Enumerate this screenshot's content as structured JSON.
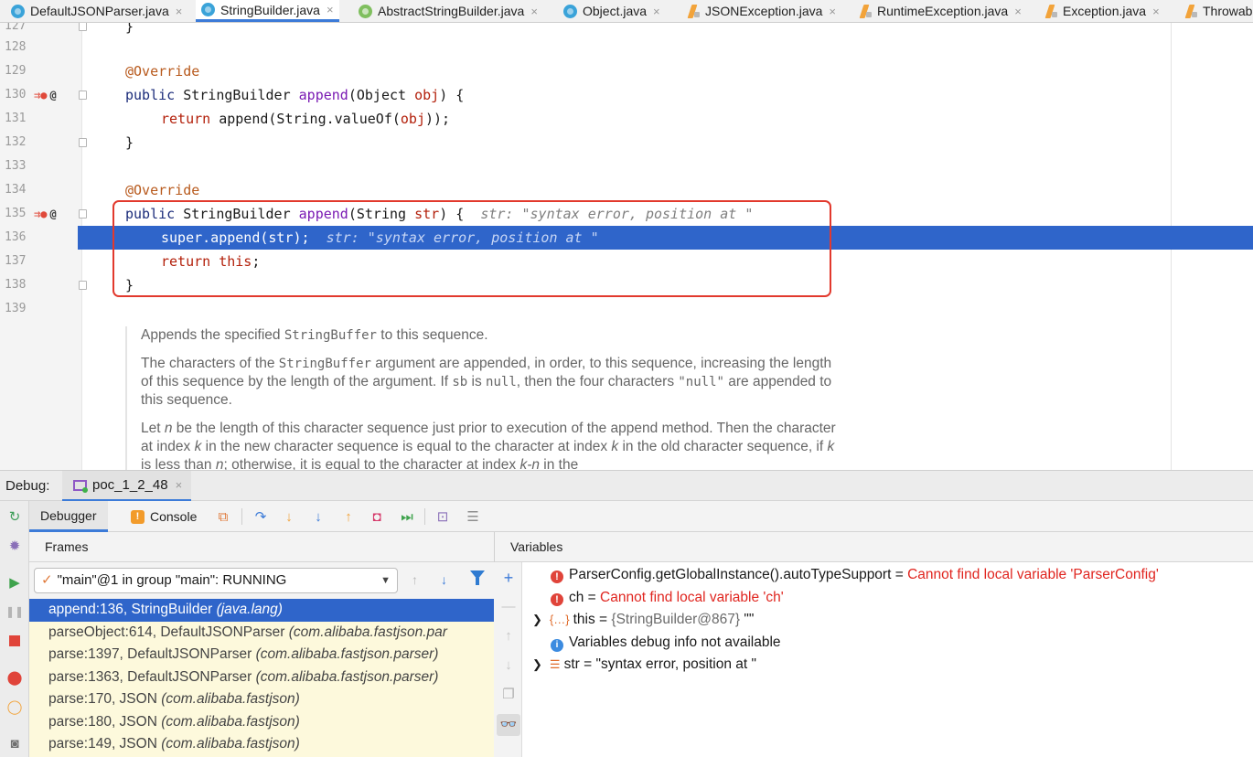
{
  "tabs": [
    {
      "label": "DefaultJSONParser.java",
      "icon": "class-icon"
    },
    {
      "label": "StringBuilder.java",
      "icon": "class-icon",
      "active": true
    },
    {
      "label": "AbstractStringBuilder.java",
      "icon": "abstract-class-icon"
    },
    {
      "label": "Object.java",
      "icon": "class-icon"
    },
    {
      "label": "JSONException.java",
      "icon": "exception-class-icon"
    },
    {
      "label": "RuntimeException.java",
      "icon": "exception-class-icon"
    },
    {
      "label": "Exception.java",
      "icon": "exception-class-icon"
    },
    {
      "label": "Throwab",
      "icon": "exception-class-icon"
    }
  ],
  "tab_close": "×",
  "editor": {
    "line_numbers": [
      "127",
      "128",
      "129",
      "130",
      "131",
      "132",
      "133",
      "134",
      "135",
      "136",
      "137",
      "138",
      "139"
    ],
    "code": {
      "l127": "}",
      "l129_annotation": "@Override",
      "l130_public": "public",
      "l130_type": "StringBuilder",
      "l130_method": "append",
      "l130_params": "(Object ",
      "l130_param": "obj",
      "l130_tail": ") {",
      "l131_return": "return",
      "l131_body": "append(String.",
      "l131_method": "valueOf",
      "l131_open": "(",
      "l131_param": "obj",
      "l131_close": "));",
      "l132": "}",
      "l134_annotation": "@Override",
      "l135_public": "public",
      "l135_type": "StringBuilder",
      "l135_method": "append",
      "l135_params": "(String ",
      "l135_param": "str",
      "l135_tail": ") {",
      "l135_hint": "str: \"syntax error, position at \"",
      "l136_body": "super.append(str);",
      "l136_hint": "str: \"syntax error, position at \"",
      "l137_return": "return",
      "l137_this": "this",
      "l137_semi": ";",
      "l138": "}"
    },
    "doc": {
      "p1_a": "Appends the specified ",
      "p1_code": "StringBuffer",
      "p1_b": " to this sequence.",
      "p2_a": "The characters of the ",
      "p2_code": "StringBuffer",
      "p2_b": " argument are appended, in order, to this sequence, increasing the length of this sequence by the length of the argument. If ",
      "p2_sb": "sb",
      "p2_c": " is ",
      "p2_null": "null",
      "p2_d": ", then the four characters ",
      "p2_nullq": "\"null\"",
      "p2_e": " are appended to this sequence.",
      "p3_a": "Let ",
      "p3_n": "n",
      "p3_b": " be the length of this character sequence just prior to execution of the append method. Then the character at index ",
      "p3_k": "k",
      "p3_c": " in the new character sequence is equal to the character at index ",
      "p3_k2": "k",
      "p3_d": " in the old character sequence, if ",
      "p3_k3": "k",
      "p3_e": " is less than ",
      "p3_n2": "n",
      "p3_f": "; otherwise, it is equal to the character at index ",
      "p3_g": "k-n",
      "p3_h": " in the"
    }
  },
  "debug": {
    "label": "Debug:",
    "session": "poc_1_2_48",
    "tabs": {
      "debugger": "Debugger",
      "console": "Console"
    },
    "frames_header": "Frames",
    "variables_header": "Variables",
    "thread": "\"main\"@1 in group \"main\": RUNNING",
    "frames": [
      {
        "method": "append:136, StringBuilder ",
        "pkg": "(java.lang)",
        "selected": true
      },
      {
        "method": "parseObject:614, DefaultJSONParser ",
        "pkg": "(com.alibaba.fastjson.par"
      },
      {
        "method": "parse:1397, DefaultJSONParser ",
        "pkg": "(com.alibaba.fastjson.parser)"
      },
      {
        "method": "parse:1363, DefaultJSONParser ",
        "pkg": "(com.alibaba.fastjson.parser)"
      },
      {
        "method": "parse:170, JSON ",
        "pkg": "(com.alibaba.fastjson)"
      },
      {
        "method": "parse:180, JSON ",
        "pkg": "(com.alibaba.fastjson)"
      },
      {
        "method": "parse:149, JSON ",
        "pkg": "(com.alibaba.fastjson)"
      }
    ],
    "variables": {
      "v1_name": "ParserConfig.getGlobalInstance().autoTypeSupport",
      "v1_eq": " = ",
      "v1_err": "Cannot find local variable 'ParserConfig'",
      "v2_name": "ch",
      "v2_eq": " = ",
      "v2_err": "Cannot find local variable 'ch'",
      "v3_name": "this",
      "v3_eq": " = ",
      "v3_type": "{StringBuilder@867}",
      "v3_val": " \"\"",
      "v4_info": "Variables debug info not available",
      "v5_name": "str",
      "v5_eq": " = ",
      "v5_val": "\"syntax error, position at \""
    }
  },
  "colors": {
    "accent": "#3c7bd8",
    "selection": "#2f65ca",
    "error": "#e0251f",
    "highlight_box": "#e2392d",
    "frames_bg": "#fdf9dc"
  }
}
